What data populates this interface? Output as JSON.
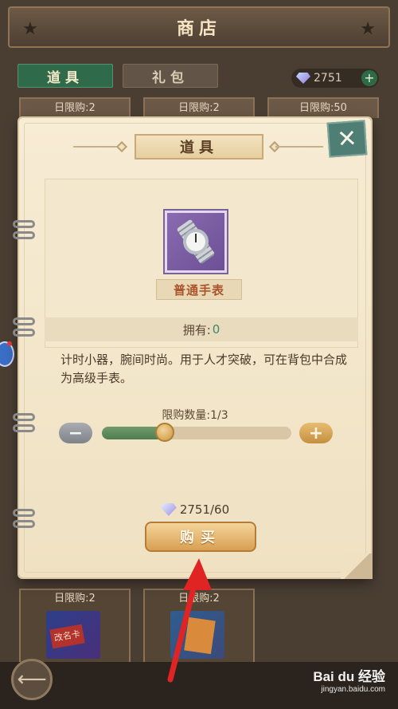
{
  "shop": {
    "title": "商店",
    "tabs": [
      "道具",
      "礼包"
    ],
    "currency_amount": "2751",
    "limit_top": [
      "日限购:2",
      "日限购:2",
      "日限购:50"
    ],
    "limit_bottom": [
      "日限购:2",
      "日限购:2"
    ]
  },
  "dialog": {
    "title": "道具",
    "item_name": "普通手表",
    "owned_label": "拥有:",
    "owned_value": "0",
    "description": "计时小器，腕间时尚。用于人才突破，可在背包中合成为高级手表。",
    "limit_label": "限购数量:1/3",
    "purchase_fraction": 0.33,
    "cost": "2751/60",
    "buy_label": "购买",
    "close_icon": "close-icon"
  },
  "icons": {
    "close": "✕",
    "minus": "−",
    "plus": "+",
    "back": "⟵",
    "star": "★",
    "add": "+"
  },
  "watermark": {
    "brand": "Bai du 经验",
    "url": "jingyan.baidu.com"
  },
  "colors": {
    "annotation_arrow": "#e02424",
    "active_tab": "#2f6a4a",
    "buy_button": "#d9a052"
  }
}
